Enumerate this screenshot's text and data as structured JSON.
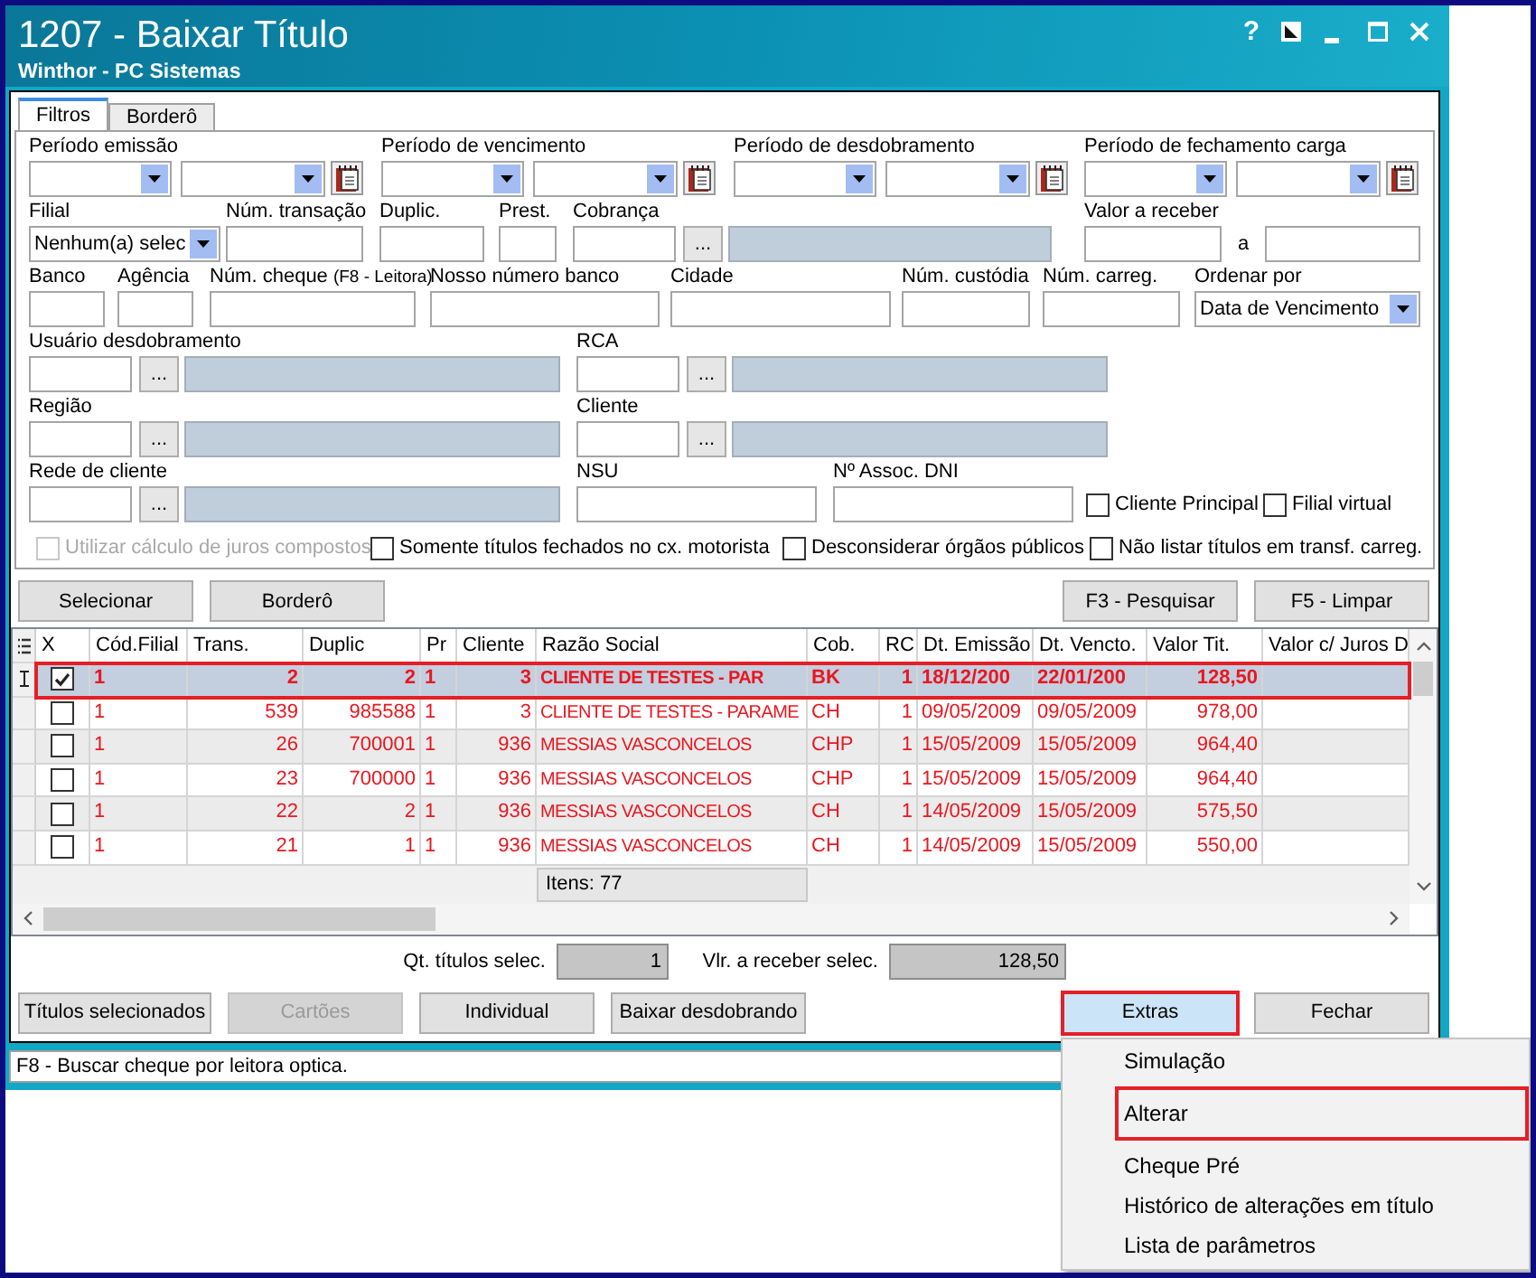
{
  "window": {
    "title": "1207 - Baixar Título",
    "subtitle": "Winthor - PC Sistemas",
    "help": "?"
  },
  "tabs": [
    {
      "label": "Filtros",
      "selected": true
    },
    {
      "label": "Borderô",
      "selected": false
    }
  ],
  "filter_rows": [
    [
      {
        "kind": "date_range",
        "label": "Período emissão"
      },
      {
        "kind": "date_range",
        "label": "Período de vencimento"
      },
      {
        "kind": "date_range",
        "label": "Período de desdobramento"
      },
      {
        "kind": "date_range",
        "label": "Período de fechamento carga"
      }
    ],
    [
      {
        "kind": "combo",
        "label": "Filial",
        "value": "Nenhum(a) selec"
      },
      {
        "kind": "text",
        "label": "Núm. transação"
      },
      {
        "kind": "text",
        "label": "Duplic."
      },
      {
        "kind": "text",
        "label": "Prest."
      },
      {
        "kind": "lookup",
        "label": "Cobrança",
        "button": "..."
      },
      {
        "kind": "range",
        "label": "Valor a receber",
        "separator": "a"
      }
    ],
    [
      {
        "kind": "text",
        "label": "Banco"
      },
      {
        "kind": "text",
        "label": "Agência"
      },
      {
        "kind": "text",
        "label": "Núm. cheque",
        "note": "(F8 - Leitora)"
      },
      {
        "kind": "text",
        "label": "Nosso número banco"
      },
      {
        "kind": "text",
        "label": "Cidade"
      },
      {
        "kind": "text",
        "label": "Núm. custódia"
      },
      {
        "kind": "text",
        "label": "Núm. carreg."
      },
      {
        "kind": "combo",
        "label": "Ordenar por",
        "value": "Data de Vencimento"
      }
    ],
    [
      {
        "kind": "lookup",
        "label": "Usuário desdobramento",
        "button": "..."
      },
      {
        "kind": "lookup",
        "label": "RCA",
        "button": "..."
      }
    ],
    [
      {
        "kind": "lookup",
        "label": "Região",
        "button": "..."
      },
      {
        "kind": "lookup",
        "label": "Cliente",
        "button": "..."
      }
    ],
    [
      {
        "kind": "lookup",
        "label": "Rede de cliente",
        "button": "..."
      },
      {
        "kind": "text",
        "label": "NSU"
      },
      {
        "kind": "text",
        "label": "Nº Assoc. DNI"
      },
      {
        "kind": "checkbox",
        "label": "Cliente Principal",
        "checked": false,
        "disabled": false
      },
      {
        "kind": "checkbox",
        "label": "Filial virtual",
        "checked": false,
        "disabled": false
      }
    ],
    [
      {
        "kind": "checkbox",
        "label": "Utilizar cálculo de juros compostos",
        "checked": false,
        "disabled": true
      },
      {
        "kind": "checkbox",
        "label": "Somente títulos fechados no cx. motorista",
        "checked": false,
        "disabled": false
      },
      {
        "kind": "checkbox",
        "label": "Desconsiderar órgãos públicos",
        "checked": false,
        "disabled": false
      },
      {
        "kind": "checkbox",
        "label": "Não listar títulos em transf. carreg.",
        "checked": false,
        "disabled": false
      }
    ]
  ],
  "filter_buttons": {
    "left": [
      "Selecionar",
      "Borderô"
    ],
    "right": [
      "F3 - Pesquisar",
      "F5 - Limpar"
    ]
  },
  "table": {
    "check_column": "X",
    "columns": [
      "Cód.Filial",
      "Trans.",
      "Duplic",
      "Pr",
      "Cliente",
      "Razão Social",
      "Cob.",
      "RC",
      "Dt. Emissão",
      "Dt. Vencto.",
      "Valor Tit.",
      "Valor c/ Juros D"
    ],
    "rows": [
      {
        "selected": true,
        "highlighted": true,
        "checked": true,
        "cells": [
          "1",
          "2",
          "2",
          "1",
          "3",
          "CLIENTE DE TESTES - PAR",
          "BK",
          "1",
          "18/12/200",
          "22/01/200",
          "128,50"
        ]
      },
      {
        "selected": false,
        "highlighted": false,
        "checked": false,
        "cells": [
          "1",
          "539",
          "985588",
          "1",
          "3",
          "CLIENTE DE TESTES - PARAME",
          "CH",
          "1",
          "09/05/2009",
          "09/05/2009",
          "978,00"
        ]
      },
      {
        "selected": false,
        "highlighted": false,
        "checked": false,
        "cells": [
          "1",
          "26",
          "700001",
          "1",
          "936",
          "MESSIAS VASCONCELOS",
          "CHP",
          "1",
          "15/05/2009",
          "15/05/2009",
          "964,40"
        ]
      },
      {
        "selected": false,
        "highlighted": false,
        "checked": false,
        "cells": [
          "1",
          "23",
          "700000",
          "1",
          "936",
          "MESSIAS VASCONCELOS",
          "CHP",
          "1",
          "15/05/2009",
          "15/05/2009",
          "964,40"
        ]
      },
      {
        "selected": false,
        "highlighted": false,
        "checked": false,
        "cells": [
          "1",
          "22",
          "2",
          "1",
          "936",
          "MESSIAS VASCONCELOS",
          "CH",
          "1",
          "14/05/2009",
          "15/05/2009",
          "575,50"
        ]
      },
      {
        "selected": false,
        "highlighted": false,
        "checked": false,
        "cells": [
          "1",
          "21",
          "1",
          "1",
          "936",
          "MESSIAS VASCONCELOS",
          "CH",
          "1",
          "14/05/2009",
          "15/05/2009",
          "550,00"
        ]
      }
    ],
    "footer": "Itens: 77"
  },
  "totals": [
    {
      "label": "Qt. títulos selec.",
      "value": "1"
    },
    {
      "label": "Vlr. a receber selec.",
      "value": "128,50"
    }
  ],
  "actions": {
    "left": [
      {
        "label": "Títulos selecionados",
        "disabled": false,
        "pressed": false,
        "highlighted": false
      },
      {
        "label": "Cartões",
        "disabled": true,
        "pressed": false,
        "highlighted": false
      },
      {
        "label": "Individual",
        "disabled": false,
        "pressed": false,
        "highlighted": false
      },
      {
        "label": "Baixar desdobrando",
        "disabled": false,
        "pressed": false,
        "highlighted": false
      }
    ],
    "right": [
      {
        "label": "Extras",
        "disabled": false,
        "pressed": true,
        "highlighted": true
      },
      {
        "label": "Fechar",
        "disabled": false,
        "pressed": false,
        "highlighted": false
      }
    ]
  },
  "status_bar": "F8 - Buscar cheque por leitora optica.",
  "menu": {
    "groups": [
      {
        "items": [
          {
            "label": "Simulação",
            "highlighted": false
          }
        ]
      },
      {
        "items": [
          {
            "label": "Alterar",
            "highlighted": true
          }
        ]
      },
      {
        "items": [
          {
            "label": "Cheque Pré",
            "highlighted": false
          },
          {
            "label": "Histórico de alterações em título",
            "highlighted": false
          },
          {
            "label": "Lista de parâmetros",
            "highlighted": false
          }
        ]
      }
    ]
  }
}
